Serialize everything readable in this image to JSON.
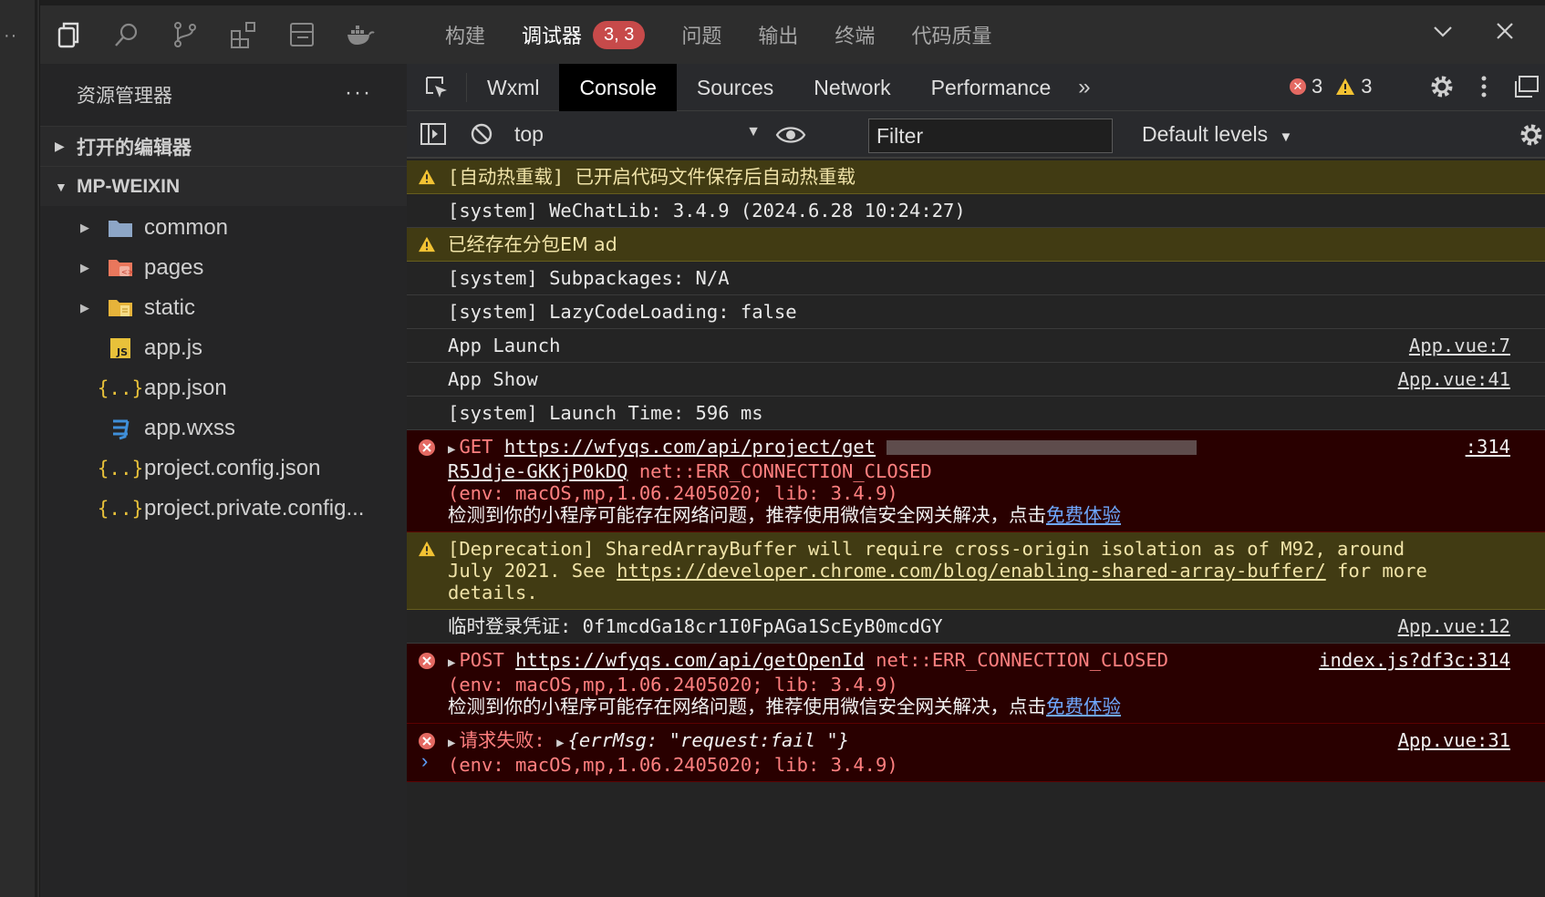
{
  "activity": {
    "more": "··"
  },
  "topbar": {
    "panel_tabs": [
      "构建",
      "调试器",
      "问题",
      "输出",
      "终端",
      "代码质量"
    ],
    "debugger_badge": "3, 3"
  },
  "sidebar": {
    "title": "资源管理器",
    "more": "···",
    "open_editors": "打开的编辑器",
    "project": "MP-WEIXIN",
    "items": [
      {
        "label": "common",
        "kind": "folder",
        "icon": "folder-icon",
        "color": "#8da6c6"
      },
      {
        "label": "pages",
        "kind": "folder",
        "icon": "pages-folder-icon",
        "color": "#e9775c"
      },
      {
        "label": "static",
        "kind": "folder",
        "icon": "static-folder-icon",
        "color": "#e6b33a"
      },
      {
        "label": "app.js",
        "kind": "file",
        "icon": "js-file-icon",
        "color": "#e8c13a"
      },
      {
        "label": "app.json",
        "kind": "file",
        "icon": "json-file-icon",
        "color": "#e8c13a"
      },
      {
        "label": "app.wxss",
        "kind": "file",
        "icon": "css-file-icon",
        "color": "#3f8fd9"
      },
      {
        "label": "project.config.json",
        "kind": "file",
        "icon": "json-file-icon",
        "color": "#e8c13a"
      },
      {
        "label": "project.private.config...",
        "kind": "file",
        "icon": "json-file-icon",
        "color": "#e8c13a"
      }
    ]
  },
  "devtools": {
    "tabs": [
      "Wxml",
      "Console",
      "Sources",
      "Network",
      "Performance"
    ],
    "more_tabs": "»",
    "error_count": "3",
    "warning_count": "3",
    "context": "top",
    "filter_placeholder": "Filter",
    "levels": "Default levels",
    "colors": {
      "warn_bg": "#413b13",
      "error_bg": "#290000",
      "error_text": "#ff8080"
    }
  },
  "console": {
    "hot_reload": "[自动热重载] 已开启代码文件保存后自动热重载",
    "wechatlib": "[system] WeChatLib: 3.4.9 (2024.6.28 10:24:27)",
    "subpkg_warn": "已经存在分包EM ad",
    "subpackages": "[system] Subpackages: N/A",
    "lazy": "[system] LazyCodeLoading: false",
    "app_launch": "App Launch",
    "app_launch_src": "App.vue:7",
    "app_show": "App Show",
    "app_show_src": "App.vue:41",
    "launch_time": "[system] Launch Time: 596 ms",
    "err1_method": "GET",
    "err1_url": "https://wfyqs.com/api/project/get",
    "err1_url2": "R5Jdje-GKKjP0kDQ",
    "err1_status": "net::ERR_CONNECTION_CLOSED",
    "err1_src": ":314",
    "env": "(env: macOS,mp,1.06.2405020; lib: 3.4.9)",
    "net_hint": "检测到你的小程序可能存在网络问题，推荐使用微信安全网关解决，点击",
    "net_hint_link": "免费体验",
    "deprecation_1": "[Deprecation] SharedArrayBuffer will require cross-origin isolation as of M92, around",
    "deprecation_2": "July 2021. See ",
    "deprecation_link": "https://developer.chrome.com/blog/enabling-shared-array-buffer/",
    "deprecation_3": " for more",
    "deprecation_4": "details.",
    "temp_login": "临时登录凭证: 0f1mcdGa18cr1I0FpAGa1ScEyB0mcdGY",
    "temp_login_src": "App.vue:12",
    "err2_method": "POST",
    "err2_url": "https://wfyqs.com/api/getOpenId",
    "err2_status": "net::ERR_CONNECTION_CLOSED",
    "err2_src": "index.js?df3c:314",
    "err3_label": "请求失败:",
    "err3_obj": "{errMsg: \"request:fail \"}",
    "err3_src": "App.vue:31",
    "prompt": "›"
  }
}
